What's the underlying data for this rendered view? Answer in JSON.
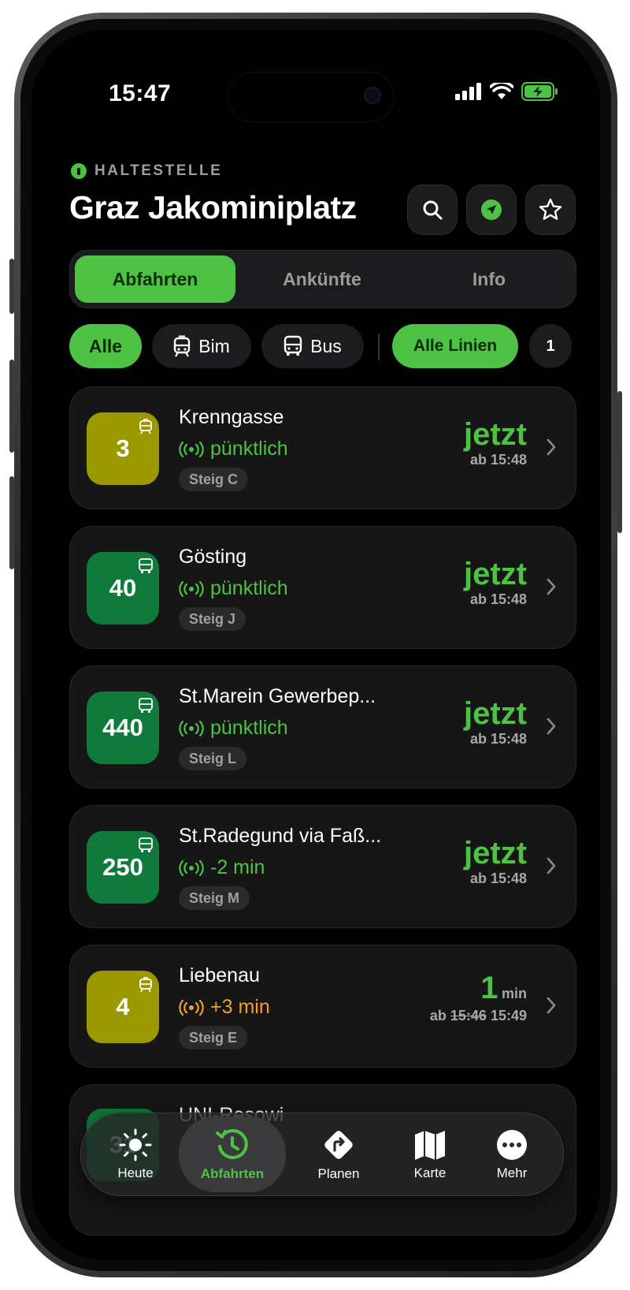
{
  "status": {
    "time": "15:47"
  },
  "header": {
    "eyebrow": "HALTESTELLE",
    "title": "Graz Jakominiplatz"
  },
  "segments": [
    "Abfahrten",
    "Ankünfte",
    "Info"
  ],
  "filters": {
    "all": "Alle",
    "tram": "Bim",
    "bus": "Bus",
    "lines": "Alle Linien",
    "count": "1"
  },
  "departures": [
    {
      "line": "3",
      "type": "tram",
      "color": "#9a9a00",
      "dest": "Krenngasse",
      "status": "pünktlich",
      "status_color": "#4ec245",
      "steig": "Steig C",
      "when": "jetzt",
      "ab": "ab 15:48"
    },
    {
      "line": "40",
      "type": "bus",
      "color": "#0f7a3c",
      "dest": "Gösting",
      "status": "pünktlich",
      "status_color": "#4ec245",
      "steig": "Steig J",
      "when": "jetzt",
      "ab": "ab 15:48"
    },
    {
      "line": "440",
      "type": "bus",
      "color": "#0f7a3c",
      "dest": "St.Marein Gewerbep...",
      "status": "pünktlich",
      "status_color": "#4ec245",
      "steig": "Steig L",
      "when": "jetzt",
      "ab": "ab 15:48"
    },
    {
      "line": "250",
      "type": "bus",
      "color": "#0f7a3c",
      "dest": "St.Radegund via Faß...",
      "status": "-2 min",
      "status_color": "#4ec245",
      "steig": "Steig M",
      "when": "jetzt",
      "ab": "ab 15:48"
    },
    {
      "line": "4",
      "type": "tram",
      "color": "#9a9a00",
      "dest": "Liebenau",
      "status": "+3 min",
      "status_color": "#f0a030",
      "steig": "Steig E",
      "when_num": "1",
      "when_unit": "min",
      "ab_prefix": "ab",
      "ab_old": "15:46",
      "ab_new": "15:49"
    },
    {
      "line": "31",
      "type": "bus",
      "color": "#0f7a3c",
      "dest": "UNI-Resowi"
    }
  ],
  "tabs": [
    "Heute",
    "Abfahrten",
    "Planen",
    "Karte",
    "Mehr"
  ],
  "icons": {
    "search": "search-icon",
    "location": "location-arrow-icon",
    "favorite": "star-icon",
    "realtime": "realtime-signal-icon",
    "tram": "tram-icon",
    "bus": "bus-icon"
  }
}
